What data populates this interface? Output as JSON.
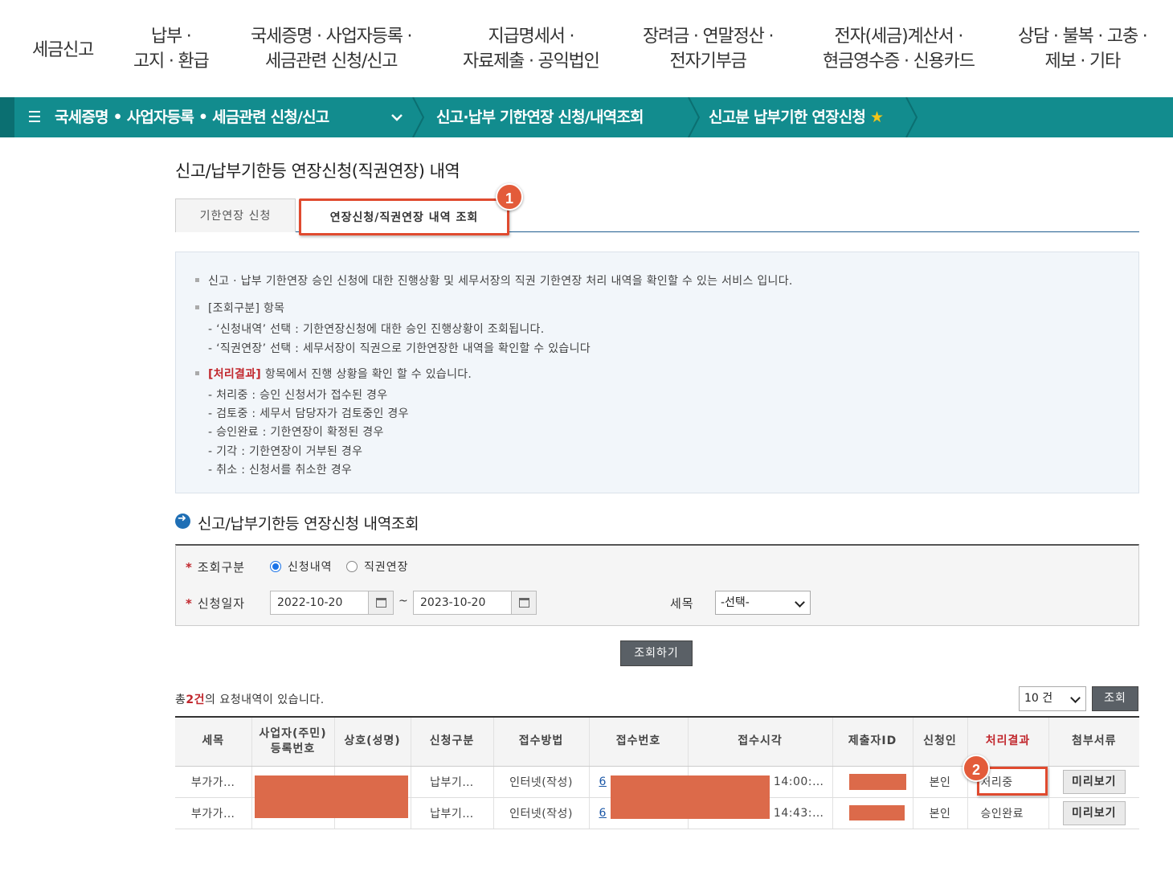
{
  "topnav": [
    {
      "l1": "세금신고",
      "l2": ""
    },
    {
      "l1": "납부 ·",
      "l2": "고지 · 환급"
    },
    {
      "l1": "국세증명 · 사업자등록 ·",
      "l2": "세금관련 신청/신고"
    },
    {
      "l1": "지급명세서 ·",
      "l2": "자료제출 · 공익법인"
    },
    {
      "l1": "장려금 · 연말정산 ·",
      "l2": "전자기부금"
    },
    {
      "l1": "전자(세금)계산서 ·",
      "l2": "현금영수증 · 신용카드"
    },
    {
      "l1": "상담 · 불복 · 고충 ·",
      "l2": "제보 · 기타"
    }
  ],
  "breadcrumb": {
    "item1": "국세증명 • 사업자등록 • 세금관련 신청/신고",
    "item2": "신고·납부 기한연장 신청/내역조회",
    "item3": "신고분 납부기한 연장신청",
    "star": "★"
  },
  "page_title": "신고/납부기한등 연장신청(직권연장) 내역",
  "tabs": {
    "tab1": "기한연장 신청",
    "tab2": "연장신청/직권연장 내역 조회"
  },
  "badges": {
    "b1": "1",
    "b2": "2"
  },
  "info": {
    "line1": "신고 · 납부 기한연장 승인 신청에 대한 진행상황 및 세무서장의 직권 기한연장 처리 내역을 확인할 수 있는 서비스 입니다.",
    "line2": "[조회구분] 항목",
    "line3": "- ‘신청내역’ 선택 : 기한연장신청에 대한 승인 진행상황이 조회됩니다.",
    "line4": "- ‘직권연장’ 선택 : 세무서장이 직권으로 기한연장한 내역을 확인할 수 있습니다",
    "line5_red": "[처리결과]",
    "line5_rest": " 항목에서 진행 상황을 확인 할 수 있습니다.",
    "s1": "- 처리중 : 승인 신청서가 접수된 경우",
    "s2": "- 검토중 : 세무서 담당자가 검토중인 경우",
    "s3": "- 승인완료 : 기한연장이 확정된 경우",
    "s4": "- 기각 : 기한연장이 거부된 경우",
    "s5": "- 취소 : 신청서를 취소한 경우"
  },
  "section_title": "신고/납부기한등 연장신청 내역조회",
  "form": {
    "star": "*",
    "type_label": "조회구분",
    "radio1": "신청내역",
    "radio2": "직권연장",
    "date_label": "신청일자",
    "date_from": "2022-10-20",
    "tilde": "~",
    "date_to": "2023-10-20",
    "tax_label": "세목",
    "tax_value": "-선택-",
    "search_btn": "조회하기"
  },
  "result": {
    "total_pre": "총",
    "total_count": "2건",
    "total_post": "의 요청내역이 있습니다.",
    "page_size": "10 건",
    "query_btn": "조회"
  },
  "table": {
    "headers": [
      "세목",
      "사업자(주민)\n등록번호",
      "상호(성명)",
      "신청구분",
      "접수방법",
      "접수번호",
      "접수시각",
      "제출자ID",
      "신청인",
      "처리결과",
      "첨부서류"
    ],
    "rows": [
      {
        "tax": "부가가…",
        "reg": "",
        "name": "",
        "type": "납부기…",
        "method": "인터넷(작성)",
        "no": "6",
        "time": "9 14:00:…",
        "id": "",
        "applicant": "본인",
        "status": "처리중",
        "attach": "미리보기"
      },
      {
        "tax": "부가가…",
        "reg": "",
        "name": "",
        "type": "납부기…",
        "method": "인터넷(작성)",
        "no": "6",
        "time": "9 14:43:…",
        "id": "",
        "applicant": "본인",
        "status": "승인완료",
        "attach": "미리보기"
      }
    ]
  },
  "colors": {
    "teal": "#128c8e",
    "highlight": "#e04a2f",
    "redact": "#dc6a4a",
    "accent_red": "#c1272d"
  }
}
